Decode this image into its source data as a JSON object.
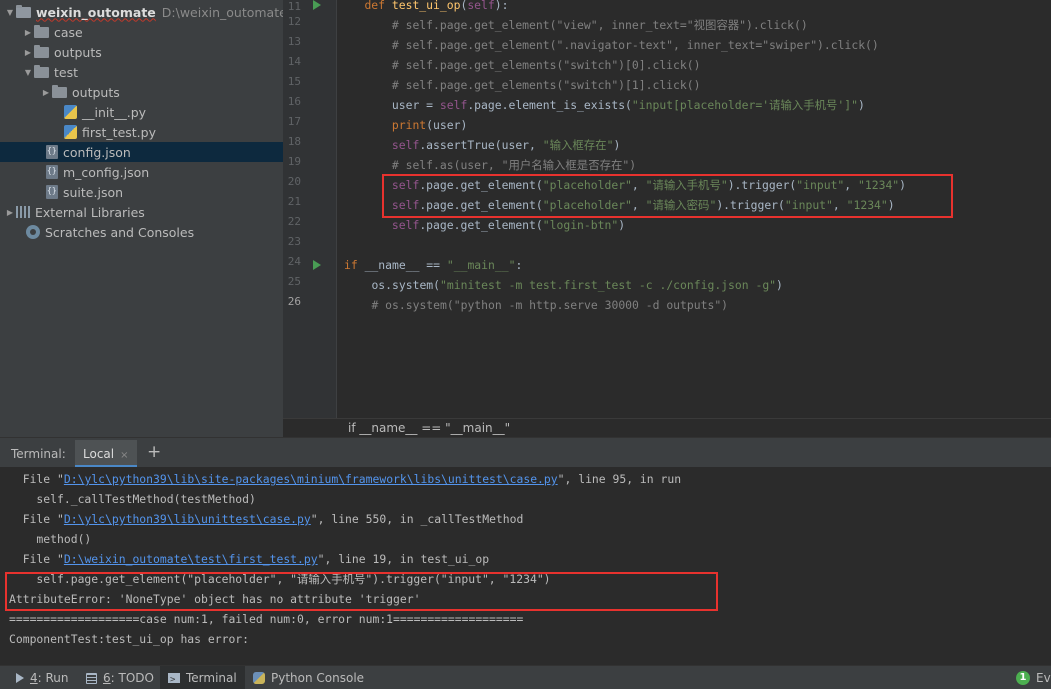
{
  "project_tree": {
    "root": {
      "name": "weixin_outomate",
      "path": "D:\\weixin_outomate"
    },
    "items": [
      {
        "label": "case"
      },
      {
        "label": "outputs"
      },
      {
        "label": "test"
      },
      {
        "label": "outputs"
      },
      {
        "label": "__init__.py"
      },
      {
        "label": "first_test.py"
      },
      {
        "label": "config.json"
      },
      {
        "label": "m_config.json"
      },
      {
        "label": "suite.json"
      },
      {
        "label": "External Libraries"
      },
      {
        "label": "Scratches and Consoles"
      }
    ]
  },
  "editor": {
    "line_numbers": [
      "11",
      "12",
      "13",
      "14",
      "15",
      "16",
      "17",
      "18",
      "19",
      "20",
      "21",
      "22",
      "23",
      "24",
      "25",
      "26"
    ],
    "lines": [
      {
        "indent": "    ",
        "def": "def ",
        "fname": "test_ui_op",
        "open": "(",
        "self": "self",
        "close": "):"
      },
      {
        "indent": "        ",
        "text": "# self.page.get_element(\"view\", inner_text=\"视图容器\").click()"
      },
      {
        "indent": "        ",
        "text": "# self.page.get_element(\".navigator-text\", inner_text=\"swiper\").click()"
      },
      {
        "indent": "        ",
        "text": "# self.page.get_elements(\"switch\")[0].click()"
      },
      {
        "indent": "        ",
        "text": "# self.page.get_elements(\"switch\")[1].click()"
      },
      {
        "indent": "        ",
        "a": "user = ",
        "self": "self",
        "b": ".page.element_is_exists(",
        "s1": "\"input[placeholder='请输入手机号']\"",
        "c": ")"
      },
      {
        "indent": "        ",
        "a": "print",
        "b": "(user)"
      },
      {
        "indent": "        ",
        "self": "self",
        "b": ".assertTrue(user, ",
        "s1": "\"输入框存在\"",
        "c": ")"
      },
      {
        "indent": "        ",
        "text": "# self.as(user, \"用户名输入框是否存在\")"
      },
      {
        "indent": "        ",
        "self": "self",
        "b": ".page.get_element(",
        "s1": "\"placeholder\"",
        "c": ", ",
        "s2": "\"请输入手机号\"",
        "d": ").trigger(",
        "s3": "\"input\"",
        "e": ", ",
        "s4": "\"1234\"",
        "f": ")"
      },
      {
        "indent": "        ",
        "self": "self",
        "b": ".page.get_element(",
        "s1": "\"placeholder\"",
        "c": ", ",
        "s2": "\"请输入密码\"",
        "d": ").trigger(",
        "s3": "\"input\"",
        "e": ", ",
        "s4": "\"1234\"",
        "f": ")"
      },
      {
        "indent": "        ",
        "self": "self",
        "b": ".page.get_element(",
        "s1": "\"login-btn\"",
        "c": ")"
      },
      {
        "text": ""
      },
      {
        "kw": "if",
        "a": " __name__ == ",
        "s1": "\"__main__\"",
        "b": ":"
      },
      {
        "indent": "    ",
        "a": "os.system(",
        "s1": "\"minitest -m test.first_test -c ./config.json -g\"",
        "b": ")"
      },
      {
        "indent": "    ",
        "text": "# os.system(\"python -m http.serve 30000 -d outputs\")"
      }
    ],
    "breadcrumb": "if __name__ == \"__main__\""
  },
  "terminal": {
    "label": "Terminal:",
    "tab": "Local",
    "tab_close": "×",
    "add": "+",
    "lines": [
      {
        "pre": "  File \"",
        "link": "D:\\ylc\\python39\\lib\\site-packages\\minium\\framework\\libs\\unittest\\case.py",
        "post": "\", line 95, in run"
      },
      {
        "text": "    self._callTestMethod(testMethod)"
      },
      {
        "pre": "  File \"",
        "link": "D:\\ylc\\python39\\lib\\unittest\\case.py",
        "post": "\", line 550, in _callTestMethod"
      },
      {
        "text": "    method()"
      },
      {
        "pre": "  File \"",
        "link": "D:\\weixin_outomate\\test\\first_test.py",
        "post": "\", line 19, in test_ui_op"
      },
      {
        "text": "    self.page.get_element(\"placeholder\", \"请输入手机号\").trigger(\"input\", \"1234\")"
      },
      {
        "text": "AttributeError: 'NoneType' object has no attribute 'trigger'"
      },
      {
        "text": "===================case num:1, failed num:0, error num:1==================="
      },
      {
        "text": "ComponentTest:test_ui_op has error:"
      }
    ]
  },
  "toolbar": {
    "run": {
      "num": "4",
      "label": ": Run"
    },
    "todo": {
      "num": "6",
      "label": ": TODO"
    },
    "terminal": "Terminal",
    "python_console": "Python Console",
    "event_count": "1",
    "event_label": "Eve"
  },
  "colors": {
    "highlight_box": "#e8322e",
    "run_marker": "#499c54",
    "link": "#5394ec",
    "selection": "#0d293e"
  }
}
